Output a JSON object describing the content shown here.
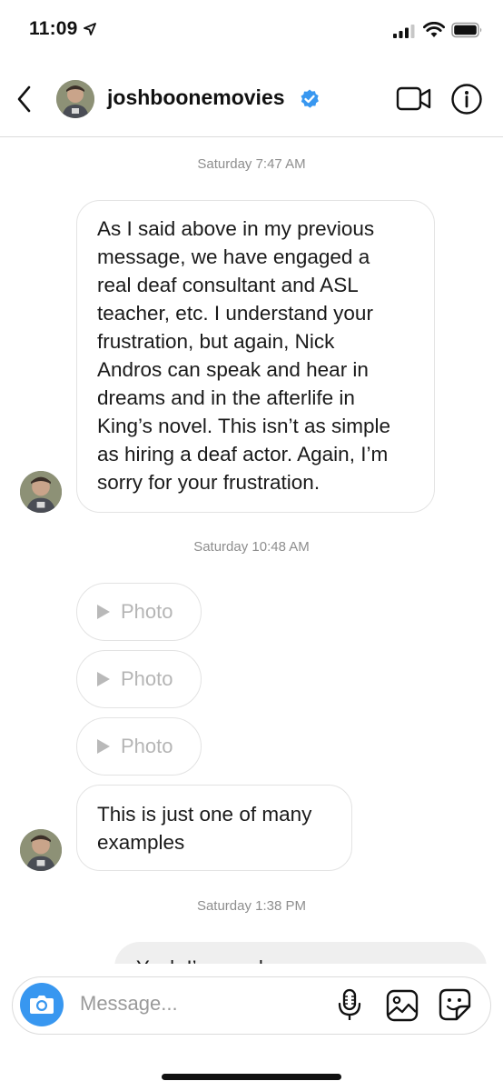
{
  "status_bar": {
    "time": "11:09"
  },
  "header": {
    "username": "joshboonemovies",
    "verified": true,
    "icons": [
      "back-chevron-icon",
      "verified-badge-icon",
      "video-call-icon",
      "info-icon"
    ]
  },
  "messages": [
    {
      "type": "timestamp",
      "text": "Saturday 7:47 AM"
    },
    {
      "type": "incoming_text",
      "lines": [
        "As I said above in my previous",
        "message, we have engaged a",
        "real deaf consultant and ASL",
        "teacher, etc. I understand your",
        "frustration, but again, Nick",
        "Andros can speak and hear in",
        "dreams and in the afterlife in",
        "King’s novel. This isn’t as simple",
        "as hiring a deaf actor. Again, I’m",
        "sorry for your frustration."
      ]
    },
    {
      "type": "timestamp",
      "text": "Saturday 10:48 AM"
    },
    {
      "type": "incoming_media",
      "label": "Photo"
    },
    {
      "type": "incoming_media",
      "label": "Photo"
    },
    {
      "type": "incoming_media",
      "label": "Photo"
    },
    {
      "type": "incoming_text",
      "lines": [
        "This is just one of many",
        "examples"
      ]
    },
    {
      "type": "timestamp",
      "text": "Saturday 1:38 PM"
    },
    {
      "type": "outgoing_text",
      "text": "Yeah I’ve read...",
      "partially_visible": true
    }
  ],
  "composer": {
    "placeholder": "Message...",
    "icons": [
      "camera-icon",
      "microphone-icon",
      "gallery-icon",
      "sticker-icon"
    ]
  },
  "colors": {
    "accent": "#3897f0",
    "verified": "#3897f0",
    "bubble_border": "#e3e3e3",
    "outgoing_bg": "#efefef",
    "timestamp": "#8e8e8e"
  }
}
